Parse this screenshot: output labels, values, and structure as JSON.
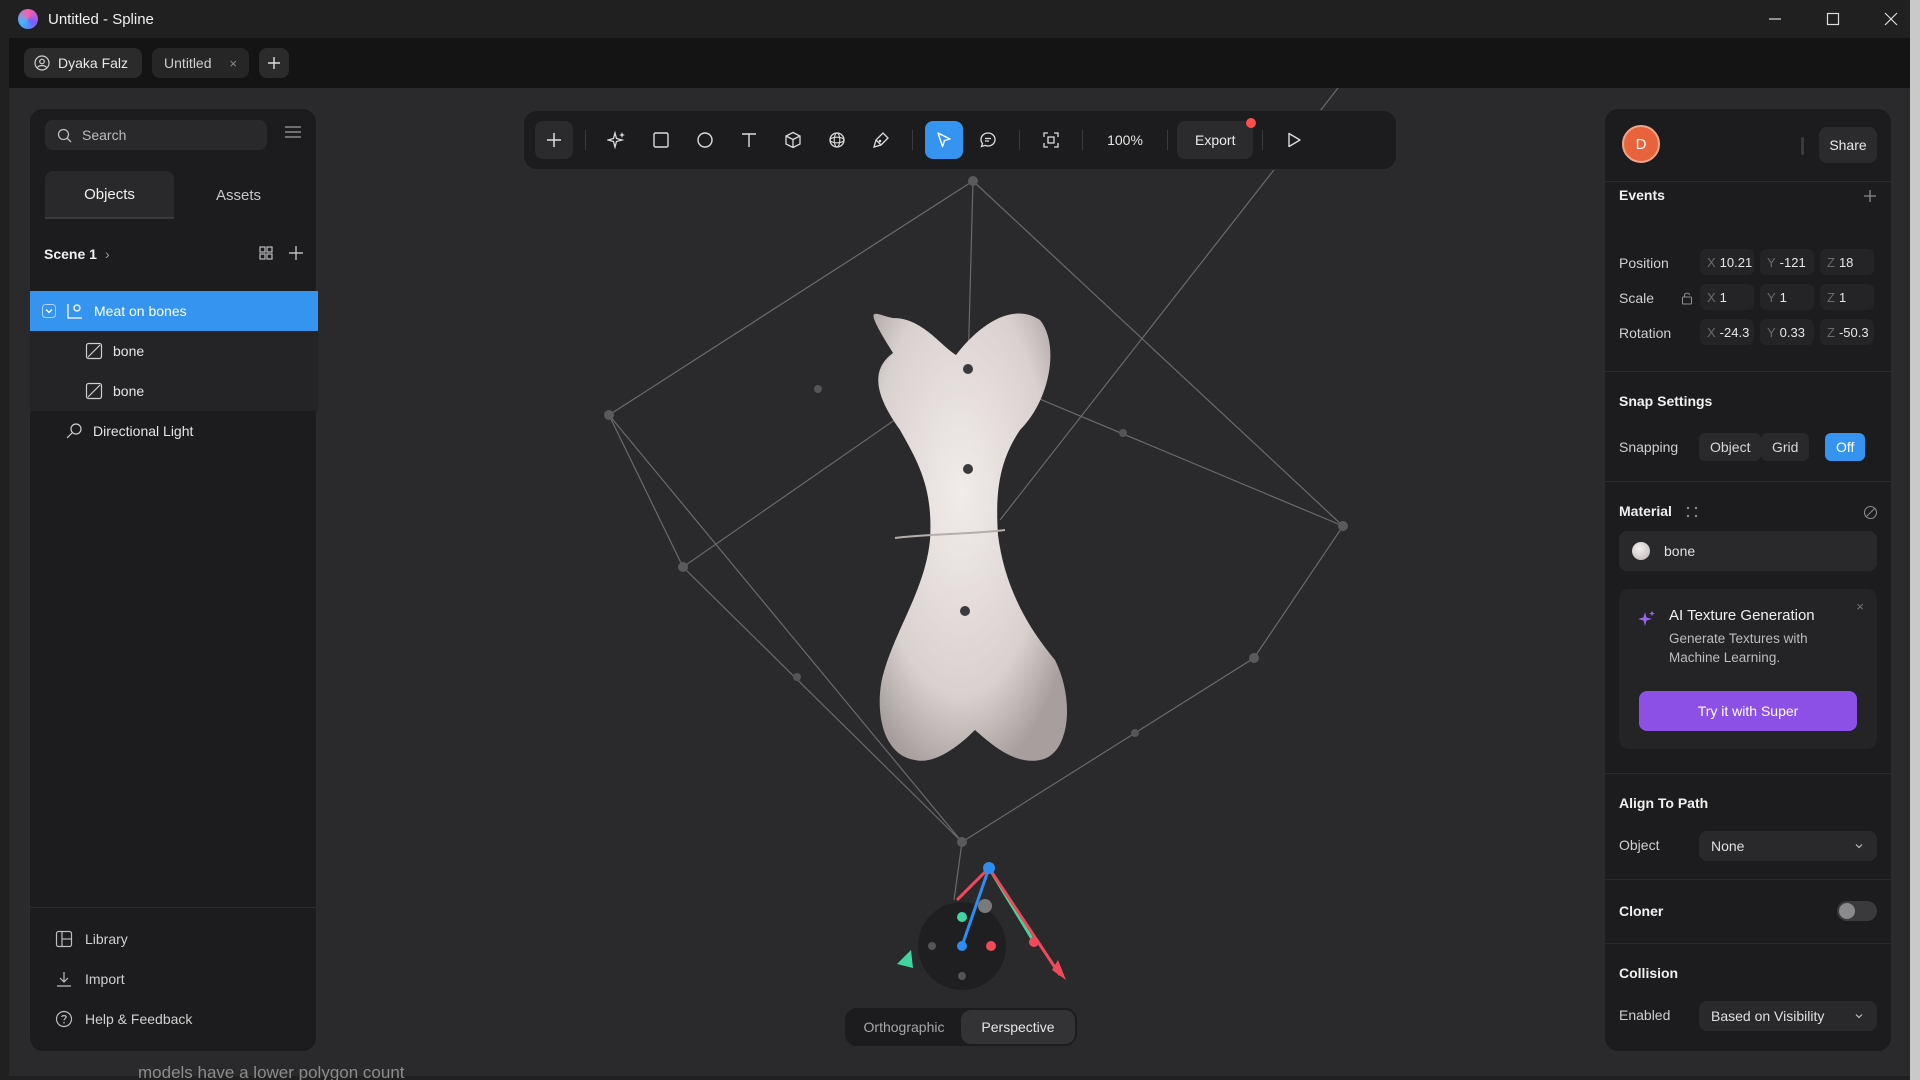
{
  "window": {
    "title": "Untitled - Spline",
    "controls": [
      "minimize-icon",
      "maximize-icon",
      "close-icon"
    ]
  },
  "tabbar": {
    "user": "Dyaka Falz",
    "file_tab": "Untitled",
    "file_tab_close": "×"
  },
  "left_panel": {
    "search_placeholder": "Search",
    "tabs": [
      "Objects",
      "Assets"
    ],
    "scene": "Scene 1",
    "tree": [
      {
        "label": "Meat on bones",
        "icon": "group-icon",
        "selected": true
      },
      {
        "label": "bone",
        "icon": "path-icon"
      },
      {
        "label": "bone",
        "icon": "path-icon"
      },
      {
        "label": "Directional Light",
        "icon": "light-icon"
      }
    ],
    "bottom": [
      "Library",
      "Import",
      "Help & Feedback"
    ]
  },
  "toolbar": {
    "tools": [
      "plus-icon",
      "ai-sparkle-icon",
      "rectangle-icon",
      "ellipse-icon",
      "text-icon",
      "cube-icon",
      "sphere-icon",
      "pen-icon",
      "pointer-icon",
      "comment-icon",
      "frame-icon"
    ],
    "zoom": "100%",
    "export_label": "Export"
  },
  "camera": {
    "options": [
      "Orthographic",
      "Perspective"
    ],
    "active": "Perspective"
  },
  "right_panel": {
    "avatar_letter": "D",
    "share_label": "Share",
    "events_title": "Events",
    "position": {
      "label": "Position",
      "x": "10.21",
      "y": "-121",
      "z": "18"
    },
    "scale": {
      "label": "Scale",
      "x": "1",
      "y": "1",
      "z": "1"
    },
    "rotation": {
      "label": "Rotation",
      "x": "-24.3",
      "y": "0.33",
      "z": "-50.3"
    },
    "snap": {
      "title": "Snap Settings",
      "label": "Snapping",
      "options": [
        "Object",
        "Grid",
        "Off"
      ],
      "active": "Off"
    },
    "material": {
      "title": "Material",
      "name": "bone"
    },
    "ai_texture": {
      "title": "AI Texture Generation",
      "description": "Generate Textures with Machine Learning.",
      "button": "Try it with Super",
      "close": "×"
    },
    "align_to_path": {
      "title": "Align To Path",
      "label": "Object",
      "value": "None"
    },
    "cloner": {
      "title": "Cloner",
      "enabled": false
    },
    "collision": {
      "title": "Collision",
      "label": "Enabled",
      "value": "Based on Visibility"
    }
  },
  "underlay_text": "models have a lower polygon count",
  "colors": {
    "accent": "#3594f0",
    "super": "#8c50e6",
    "badge": "#ff4d4d",
    "avatar": "#e8623b"
  }
}
